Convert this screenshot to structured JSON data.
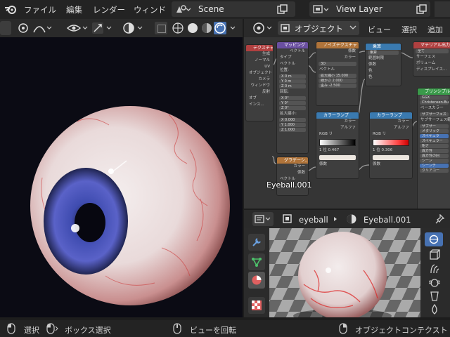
{
  "topbar": {
    "menus": [
      "ファイル",
      "編集",
      "レンダー",
      "ウィンド"
    ],
    "scene_name": "Scene",
    "view_layer_name": "View Layer"
  },
  "node_editor": {
    "object_mode_label": "オブジェクト",
    "menus": [
      "ビュー",
      "選択",
      "追加"
    ],
    "hover_label": "Eyeball.001",
    "nodes": {
      "texcoord": {
        "title": "テクスチャ",
        "rows": [
          "生成",
          "ノーマル",
          "UV",
          "オブジェクト",
          "カメラ",
          "ウィンドウ",
          "反射",
          "オブ",
          "インス..."
        ]
      },
      "mapping": {
        "title": "マッピング",
        "rows": [
          "ベクトル",
          "タイプ",
          "ポイ",
          "ベクトル",
          "位置:",
          "回転:",
          "拡大縮小:"
        ],
        "loc": [
          "X  0 m",
          "Y  0 m",
          "Z  0 m"
        ],
        "rot": [
          "X  0°",
          "Y  0°",
          "Z  0°"
        ],
        "scale": [
          "X  0.000",
          "Y  1.000",
          "Z  1.000"
        ]
      },
      "noise": {
        "title": "ノイズテクスチャ",
        "rows": [
          "係数",
          "カラー",
          "3D",
          "ベクトル"
        ],
        "inputs": [
          "拡大縮小 15.000",
          "細かさ 2.000",
          "歪み -2.500"
        ]
      },
      "mix": {
        "title": "乗算",
        "rows": [
          "乗算",
          "範囲制限",
          "係数",
          "色",
          "色"
        ]
      },
      "material_out": {
        "title": "マテリアル出力",
        "rows": [
          "全て",
          "サーフェス",
          "ボリューム",
          "ディスプレイス..."
        ]
      },
      "bsdf": {
        "title": "プリンシプルBSDF",
        "rows": [
          "GGX",
          "Christensen-Burley",
          "ベースカラー",
          "サブサーフェス",
          "サブサーフェス範囲",
          "サブサー",
          "メタリック",
          "スペキュラ",
          "スペキュラー",
          "粗さ",
          "異方性",
          "異方性の回",
          "シーン",
          "シーンチ",
          "クリアコー"
        ]
      },
      "ramp1": {
        "title": "カラーランプ",
        "rows": [
          "カラー",
          "アルファ",
          "RGB",
          "リ",
          "1",
          "位 0.467",
          "係数"
        ]
      },
      "ramp2": {
        "title": "カラーランプ",
        "rows": [
          "カラー",
          "アルファ",
          "RGB",
          "リ",
          "1",
          "位 0.306",
          "係数"
        ]
      },
      "gradient": {
        "title": "グラデーシ...",
        "rows": [
          "カラー",
          "係数",
          "ベクトル"
        ]
      }
    }
  },
  "properties": {
    "object_name": "eyeball",
    "material_name": "Eyeball.001"
  },
  "statusbar": {
    "select": "選択",
    "box_select": "ボックス選択",
    "rotate_view": "ビューを回転",
    "object_context": "オブジェクトコンテクスト"
  }
}
